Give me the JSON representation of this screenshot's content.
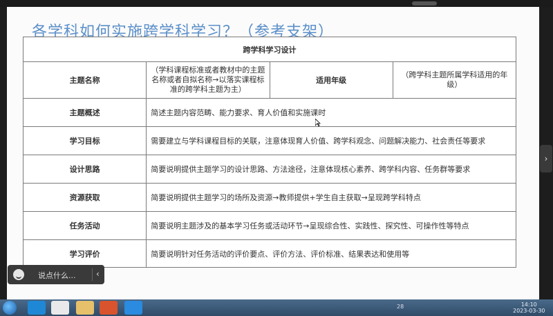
{
  "slide_title": "各学科如何实施跨学科学习？（参考支架）",
  "table": {
    "header": "跨学科学习设计",
    "theme_name": {
      "label": "主题名称",
      "desc": "（学科课程标准或者教材中的主题名称或者自拟名称→以落实课程标准的跨学科主题为主）",
      "grade_label": "适用年级",
      "grade_desc": "（跨学科主题所属学科适用的年级）"
    },
    "rows": [
      {
        "label": "主题概述",
        "desc": "简述主题内容范畴、能力要求、育人价值和实施课时"
      },
      {
        "label": "学习目标",
        "desc": "需要建立与学科课程目标的关联，注意体现育人价值、跨学科观念、问题解决能力、社会责任等要求"
      },
      {
        "label": "设计思路",
        "desc": "简要说明提供主题学习的设计思路、方法途径，注意体现核心素养、跨学科内容、任务群等要求"
      },
      {
        "label": "资源获取",
        "desc": "简要说明提供主题学习的场所及资源→教师提供+学生自主获取→呈现跨学科特点"
      },
      {
        "label": "任务活动",
        "desc": "简要说明主题涉及的基本学习任务或活动环节→呈现综合性、实践性、探究性、可操作性等特点"
      },
      {
        "label": "学习评价",
        "desc": "简要说明针对任务活动的评价要点、评价方法、评价标准、结果表达和使用等"
      }
    ]
  },
  "chat": {
    "placeholder": "说点什么...",
    "icon": "smile-icon"
  },
  "taskbar": {
    "time": "14:10",
    "date": "2023-03-30",
    "tray_text": "28"
  },
  "colors": {
    "title": "#5b8fc9",
    "taskbar": "#3a5a7a"
  }
}
